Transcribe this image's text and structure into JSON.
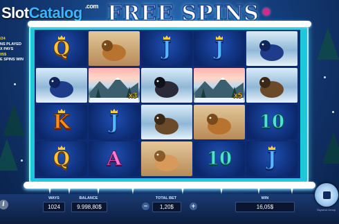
{
  "watermark": {
    "part1": "Slot",
    "part2": "Catalog",
    "domain": ".com"
  },
  "title": "FREE SPINS",
  "left_info": [
    {
      "text": "/24",
      "tone": "gold"
    },
    {
      "text": "NS PLAYED",
      "tone": "white"
    },
    {
      "text": "X PAYS",
      "tone": "white"
    },
    {
      "text": "05$",
      "tone": "gold"
    },
    {
      "text": "E SPINS WIN",
      "tone": "white"
    }
  ],
  "reels": [
    [
      {
        "kind": "letter",
        "text": "Q",
        "style": "gold",
        "crown": true
      },
      {
        "kind": "animal",
        "name": "chipmunk-symbol",
        "style": "stack"
      },
      {
        "kind": "letter",
        "text": "J",
        "style": "blue",
        "crown": true
      },
      {
        "kind": "letter",
        "text": "J",
        "style": "blue",
        "crown": true
      },
      {
        "kind": "animal",
        "name": "hare-symbol",
        "style": "snow"
      }
    ],
    [
      {
        "kind": "animal",
        "name": "hare-symbol",
        "style": "snow"
      },
      {
        "kind": "animal",
        "name": "winter-scene-multiplier",
        "style": "scene",
        "mult": "x3"
      },
      {
        "kind": "animal",
        "name": "grouse-symbol",
        "style": "snow"
      },
      {
        "kind": "animal",
        "name": "winter-scene-multiplier",
        "style": "scene",
        "mult": "x5"
      },
      {
        "kind": "animal",
        "name": "chamois-symbol",
        "style": "snow"
      }
    ],
    [
      {
        "kind": "letter",
        "text": "K",
        "style": "orange",
        "crown": true
      },
      {
        "kind": "letter",
        "text": "J",
        "style": "blue",
        "crown": true
      },
      {
        "kind": "animal",
        "name": "chamois-symbol",
        "style": "snow"
      },
      {
        "kind": "animal",
        "name": "chipmunk-symbol",
        "style": "stack"
      },
      {
        "kind": "letter",
        "text": "10",
        "style": "teal",
        "crown": false
      }
    ],
    [
      {
        "kind": "letter",
        "text": "Q",
        "style": "gold",
        "crown": true
      },
      {
        "kind": "letter",
        "text": "A",
        "style": "pink",
        "crown": false
      },
      {
        "kind": "animal",
        "name": "lynx-symbol",
        "style": "stack"
      },
      {
        "kind": "letter",
        "text": "10",
        "style": "teal",
        "crown": false
      },
      {
        "kind": "letter",
        "text": "J",
        "style": "blue",
        "crown": true
      }
    ]
  ],
  "controls": {
    "ways_label": "WAYS",
    "ways_value": "1024",
    "balance_label": "BALANCE",
    "balance_value": "9.998,80$",
    "total_bet_label": "TOTAL BET",
    "total_bet_value": "1,20$",
    "win_label": "WIN",
    "win_value": "16,05$",
    "minus": "−",
    "plus": "+",
    "info": "i"
  },
  "footer_text": "Skywind Group"
}
